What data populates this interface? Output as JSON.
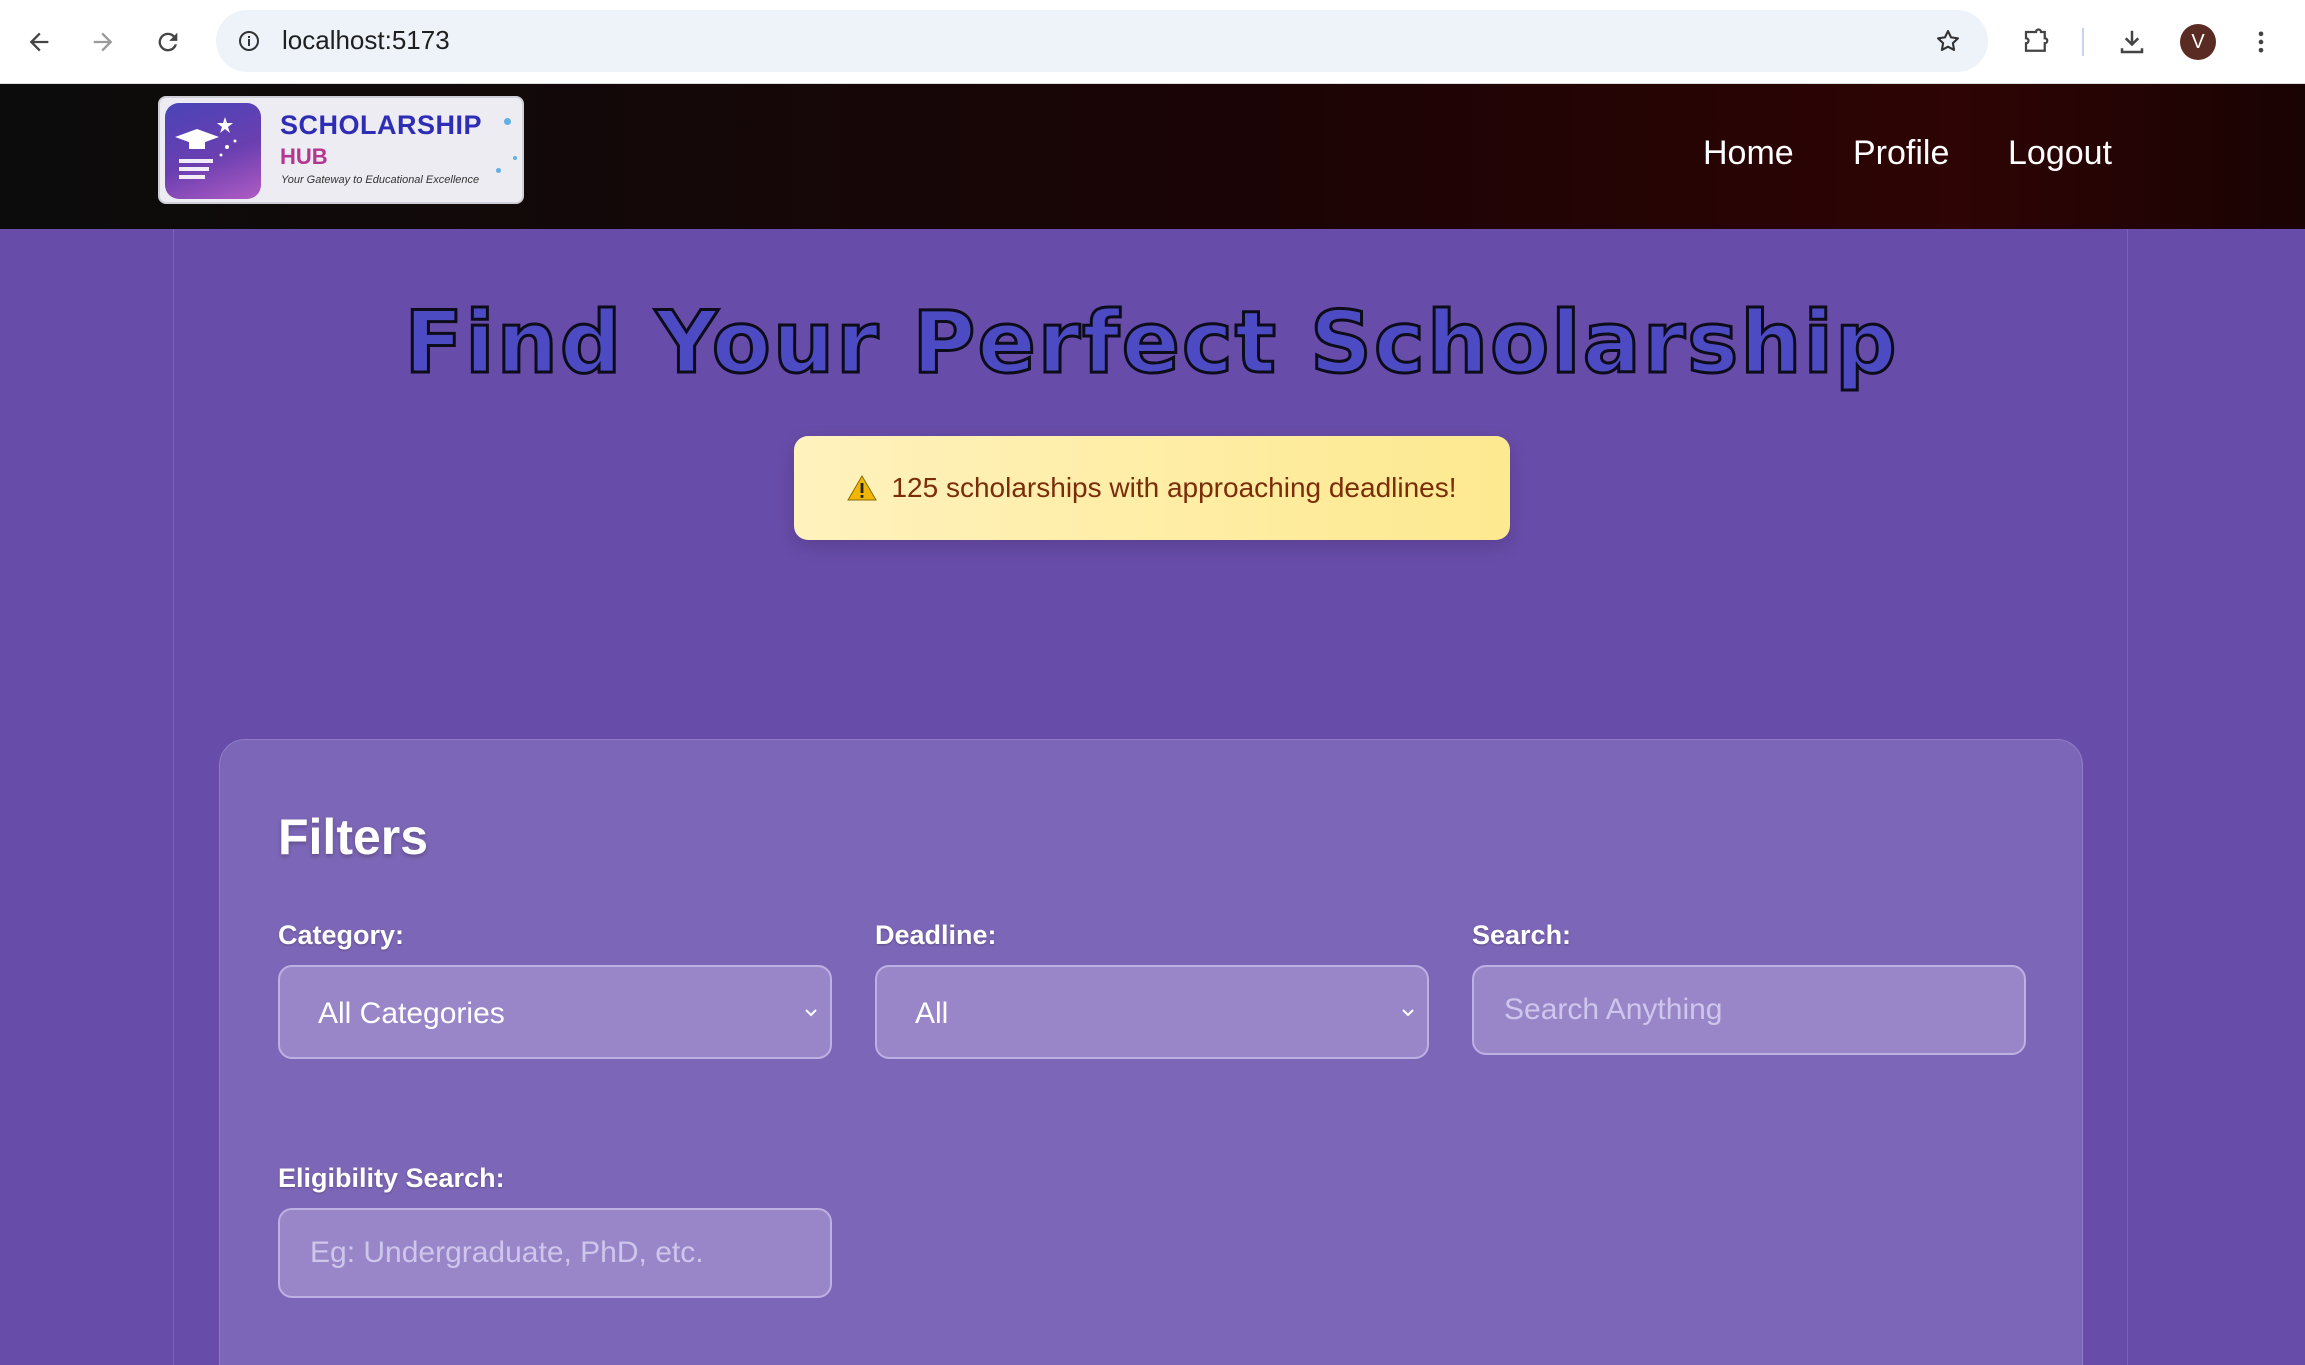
{
  "browser": {
    "url": "localhost:5173",
    "profile_initial": "V",
    "icons": [
      "back-arrow-icon",
      "forward-arrow-icon",
      "reload-icon",
      "site-info-icon",
      "bookmark-star-icon",
      "extensions-puzzle-icon",
      "download-icon",
      "more-vert-icon"
    ]
  },
  "header": {
    "logo": {
      "line1": "SCHOLARSHIP",
      "line2": "HUB",
      "tagline": "Your Gateway to Educational Excellence"
    },
    "nav": [
      {
        "label": "Home"
      },
      {
        "label": "Profile"
      },
      {
        "label": "Logout"
      }
    ]
  },
  "hero": {
    "title": "Find Your Perfect Scholarship"
  },
  "alert": {
    "icon": "warning-icon",
    "text": "125 scholarships with approaching deadlines!"
  },
  "filters": {
    "title": "Filters",
    "category": {
      "label": "Category:",
      "value": "All Categories"
    },
    "deadline": {
      "label": "Deadline:",
      "value": "All"
    },
    "search": {
      "label": "Search:",
      "placeholder": "Search Anything"
    },
    "eligibility": {
      "label": "Eligibility Search:",
      "placeholder": "Eg: Undergraduate, PhD, etc."
    }
  },
  "colors": {
    "page_bg": "#684ca9",
    "panel_bg": "#7c66b7",
    "alert_bg": "#fde98f",
    "alert_text": "#7b2c08",
    "header_bg": "#1b0405",
    "title_fill": "#4d4bc4"
  }
}
